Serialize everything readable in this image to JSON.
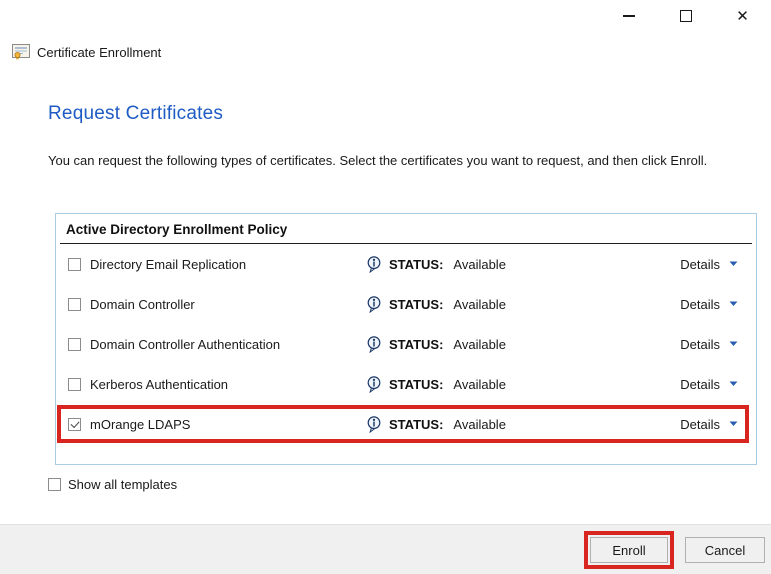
{
  "window": {
    "app_title": "Certificate Enrollment",
    "icons": {
      "app": "certificate-icon",
      "minimize": "minimize-icon",
      "maximize": "maximize-icon",
      "close": "close-icon"
    },
    "close_glyph": "✕"
  },
  "page": {
    "title": "Request Certificates",
    "description": "You can request the following types of certificates. Select the certificates you want to request, and then click Enroll."
  },
  "policy_panel": {
    "title": "Active Directory Enrollment Policy",
    "status_label": "STATUS:",
    "details_label": "Details",
    "templates": [
      {
        "name": "Directory Email Replication",
        "status": "Available",
        "checked": false,
        "highlighted": false
      },
      {
        "name": "Domain Controller",
        "status": "Available",
        "checked": false,
        "highlighted": false
      },
      {
        "name": "Domain Controller Authentication",
        "status": "Available",
        "checked": false,
        "highlighted": false
      },
      {
        "name": "Kerberos Authentication",
        "status": "Available",
        "checked": false,
        "highlighted": false
      },
      {
        "name": "mOrange LDAPS",
        "status": "Available",
        "checked": true,
        "highlighted": true
      }
    ]
  },
  "show_all_templates": {
    "label": "Show all templates",
    "checked": false
  },
  "footer": {
    "enroll_label": "Enroll",
    "cancel_label": "Cancel",
    "enroll_highlighted": true
  },
  "colors": {
    "heading_blue": "#1f5bc4",
    "panel_border": "#a9cbe3",
    "annotation_red": "#d9251f",
    "caret_blue": "#2a5db0",
    "footer_gray": "#f0f0f0"
  }
}
